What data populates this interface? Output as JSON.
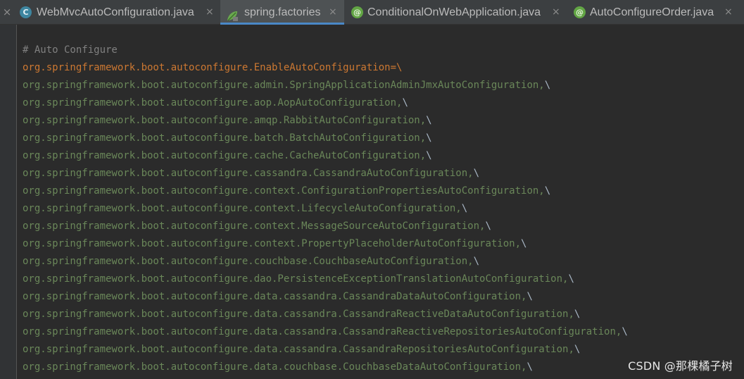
{
  "tabs": [
    {
      "icon": "class-c-icon",
      "icon_glyph": "C",
      "label": "WebMvcAutoConfiguration.java",
      "close": "×",
      "active": false
    },
    {
      "icon": "spring-leaf-icon",
      "icon_glyph": "",
      "label": "spring.factories",
      "close": "×",
      "active": true
    },
    {
      "icon": "annotation-icon",
      "icon_glyph": "@",
      "label": "ConditionalOnWebApplication.java",
      "close": "×",
      "active": false
    },
    {
      "icon": "annotation-icon",
      "icon_glyph": "@",
      "label": "AutoConfigureOrder.java",
      "close": "×",
      "active": false
    }
  ],
  "gutter_tab_close": "×",
  "editor": {
    "comment": "# Auto Configure",
    "key_line": "org.springframework.boot.autoconfigure.EnableAutoConfiguration=\\",
    "value_lines": [
      "org.springframework.boot.autoconfigure.admin.SpringApplicationAdminJmxAutoConfiguration,",
      "org.springframework.boot.autoconfigure.aop.AopAutoConfiguration,",
      "org.springframework.boot.autoconfigure.amqp.RabbitAutoConfiguration,",
      "org.springframework.boot.autoconfigure.batch.BatchAutoConfiguration,",
      "org.springframework.boot.autoconfigure.cache.CacheAutoConfiguration,",
      "org.springframework.boot.autoconfigure.cassandra.CassandraAutoConfiguration,",
      "org.springframework.boot.autoconfigure.context.ConfigurationPropertiesAutoConfiguration,",
      "org.springframework.boot.autoconfigure.context.LifecycleAutoConfiguration,",
      "org.springframework.boot.autoconfigure.context.MessageSourceAutoConfiguration,",
      "org.springframework.boot.autoconfigure.context.PropertyPlaceholderAutoConfiguration,",
      "org.springframework.boot.autoconfigure.couchbase.CouchbaseAutoConfiguration,",
      "org.springframework.boot.autoconfigure.dao.PersistenceExceptionTranslationAutoConfiguration,",
      "org.springframework.boot.autoconfigure.data.cassandra.CassandraDataAutoConfiguration,",
      "org.springframework.boot.autoconfigure.data.cassandra.CassandraReactiveDataAutoConfiguration,",
      "org.springframework.boot.autoconfigure.data.cassandra.CassandraReactiveRepositoriesAutoConfiguration,",
      "org.springframework.boot.autoconfigure.data.cassandra.CassandraRepositoriesAutoConfiguration,",
      "org.springframework.boot.autoconfigure.data.couchbase.CouchbaseDataAutoConfiguration,"
    ],
    "line_continuation": "\\"
  },
  "watermark": "CSDN @那棵橘子树",
  "colors": {
    "background": "#2b2b2b",
    "comment": "#808080",
    "key": "#cc7832",
    "value": "#6a8759",
    "active_tab_underline": "#4a88c7"
  }
}
